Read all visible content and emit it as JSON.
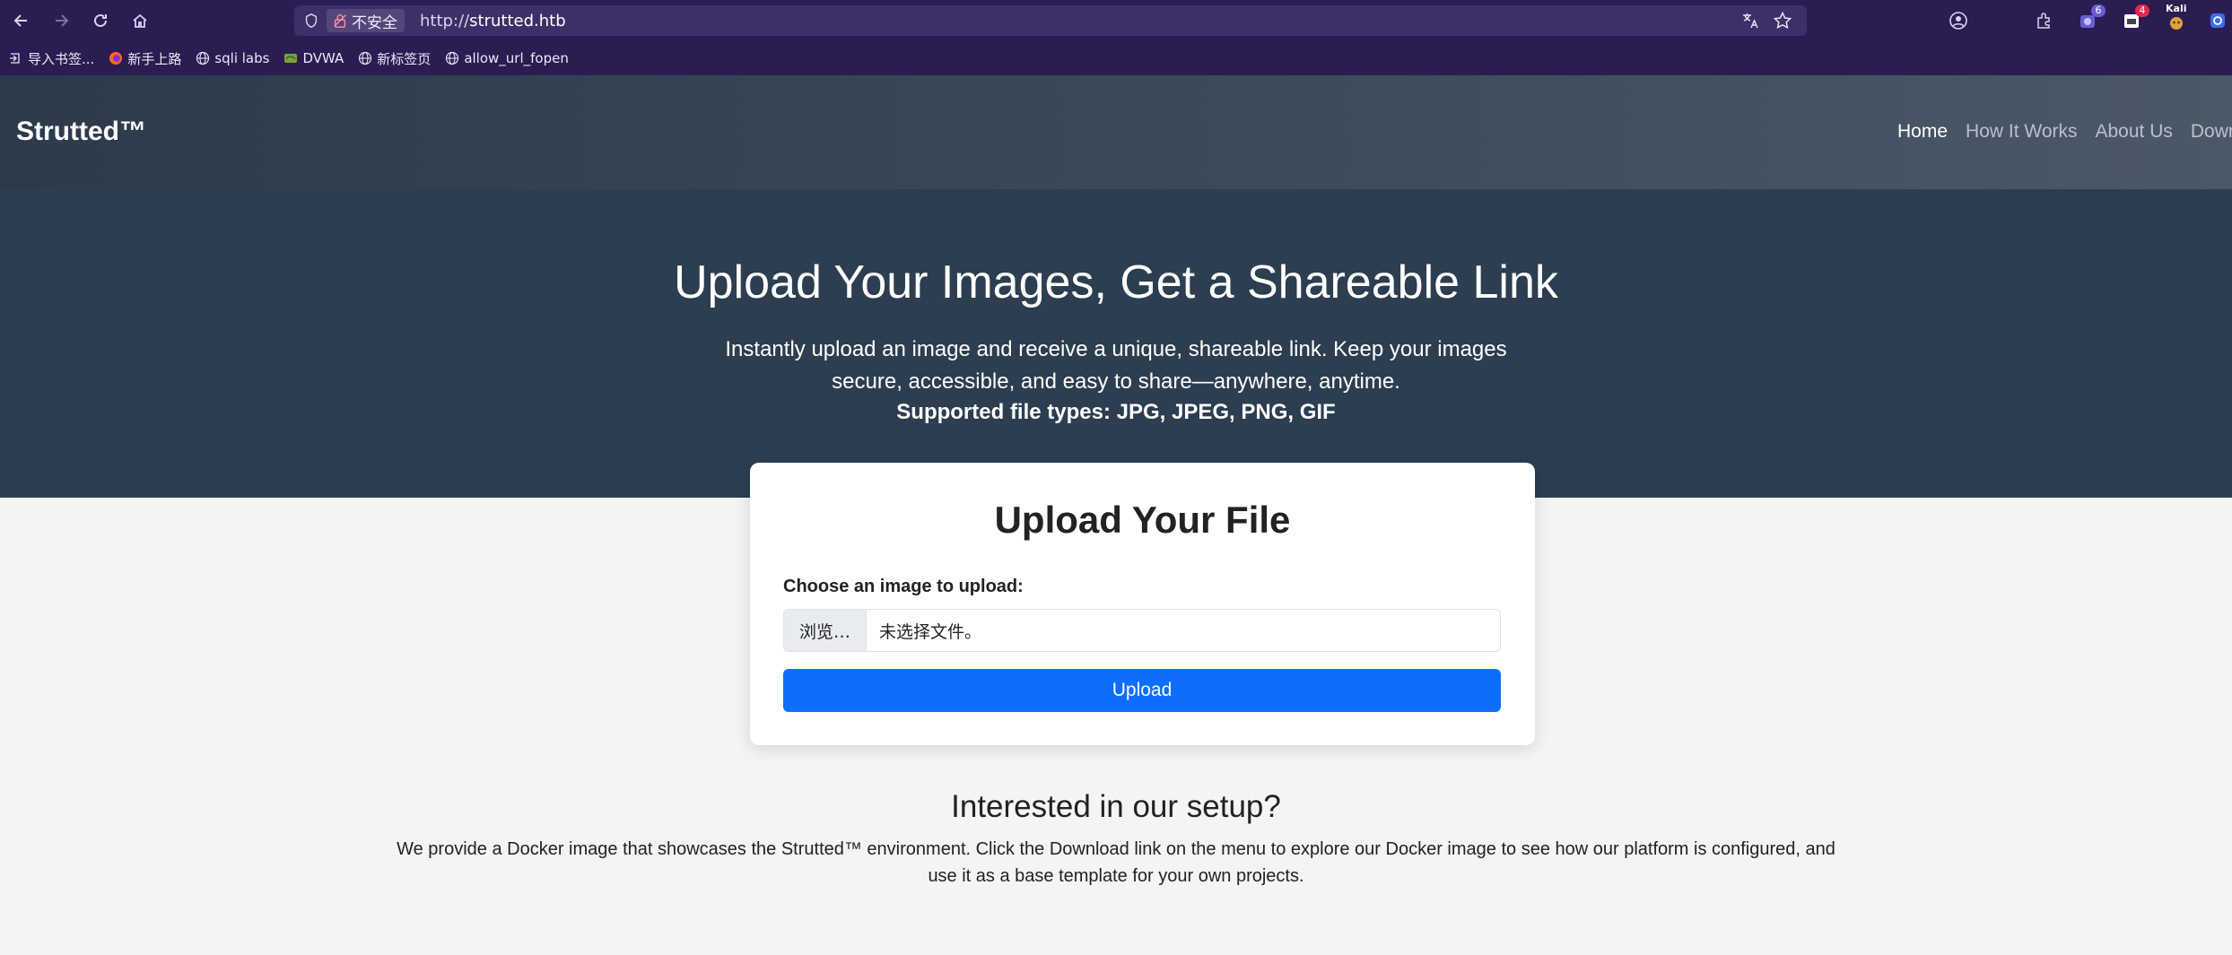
{
  "browser": {
    "insecure_label": "不安全",
    "url_scheme": "http://",
    "url_host": "strutted.htb",
    "extensions": [
      {
        "name": "account-icon",
        "badge": ""
      },
      {
        "name": "puzzle-icon",
        "badge": ""
      },
      {
        "name": "extension-a-icon",
        "badge": "6"
      },
      {
        "name": "extension-b-icon",
        "badge": "4"
      },
      {
        "name": "kali-icon",
        "badge": "Kali"
      },
      {
        "name": "extension-c-icon",
        "badge": ""
      }
    ],
    "bookmarks": [
      {
        "label": "导入书签...",
        "icon": "import-icon"
      },
      {
        "label": "新手上路",
        "icon": "firefox-icon"
      },
      {
        "label": "sqli labs",
        "icon": "globe-icon"
      },
      {
        "label": "DVWA",
        "icon": "dvwa-icon"
      },
      {
        "label": "新标签页",
        "icon": "globe-icon"
      },
      {
        "label": "allow_url_fopen",
        "icon": "globe-icon"
      }
    ]
  },
  "site": {
    "brand": "Strutted™",
    "nav": [
      "Home",
      "How It Works",
      "About Us",
      "Download"
    ],
    "active_nav": "Home"
  },
  "hero": {
    "title": "Upload Your Images, Get a Shareable Link",
    "lead": "Instantly upload an image and receive a unique, shareable link. Keep your images secure, accessible, and easy to share—anywhere, anytime.",
    "types": "Supported file types: JPG, JPEG, PNG, GIF"
  },
  "upload": {
    "title": "Upload Your File",
    "label": "Choose an image to upload:",
    "browse": "浏览…",
    "no_file": "未选择文件。",
    "button": "Upload"
  },
  "setup": {
    "title": "Interested in our setup?",
    "text": "We provide a Docker image that showcases the Strutted™ environment. Click the Download link on the menu to explore our Docker image to see how our platform is configured, and use it as a base template for your own projects."
  },
  "colors": {
    "chrome_bg": "#2b1d52",
    "hero_bg": "#2c3e50",
    "primary": "#0d6efd",
    "page_bg": "#f4f4f4"
  }
}
